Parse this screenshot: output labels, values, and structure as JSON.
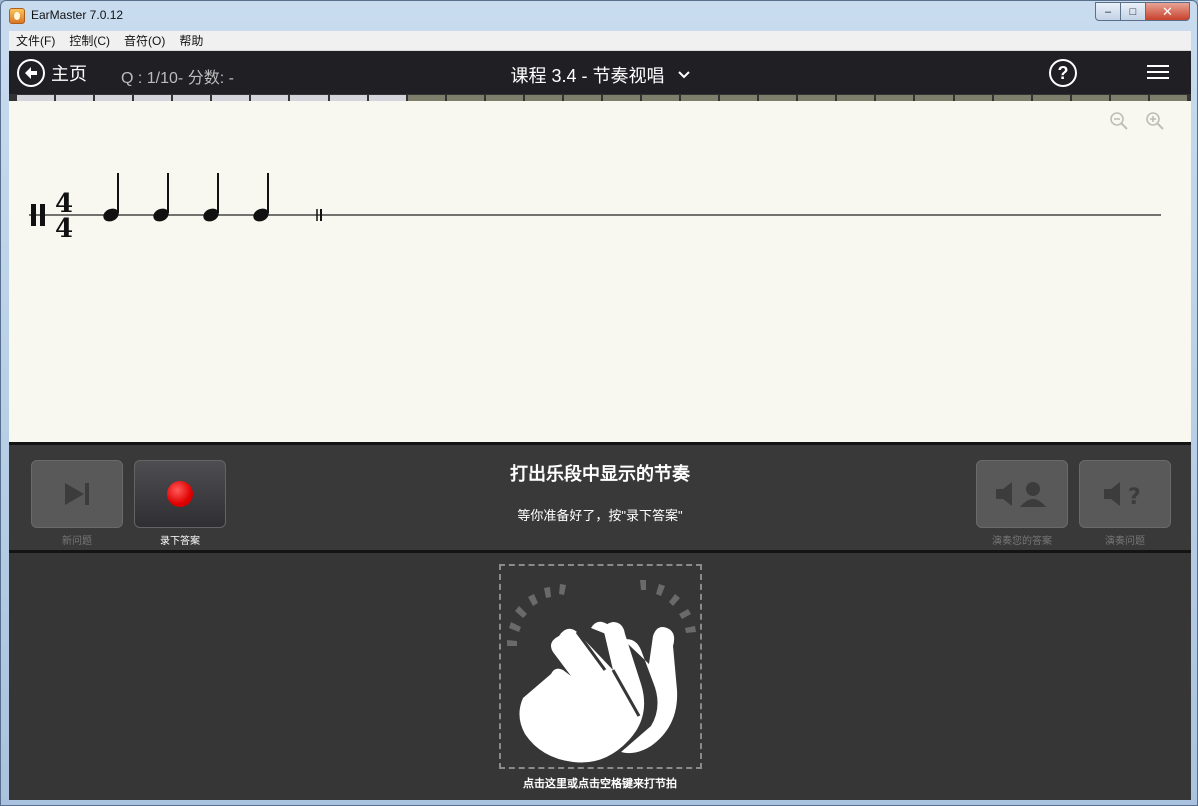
{
  "window": {
    "title": "EarMaster 7.0.12",
    "minimize": "–",
    "maximize": "□",
    "close": "✕"
  },
  "menubar": [
    "文件(F)",
    "控制(C)",
    "音符(O)",
    "帮助"
  ],
  "topbar": {
    "home_label": "主页",
    "question_info": "Q : 1/10- 分数: -",
    "lesson_title": "课程 3.4 - 节奏视唱",
    "help_label": "?"
  },
  "progress": {
    "total_segments": 30,
    "completed_segments": 10,
    "done_color": "#d3d4dc",
    "pending_color": "#7e7e6c"
  },
  "score": {
    "time_signature": {
      "numerator": "4",
      "denominator": "4"
    },
    "notes": [
      "quarter",
      "quarter",
      "quarter",
      "quarter"
    ]
  },
  "controls": {
    "instruction_title": "打出乐段中显示的节奏",
    "instruction_sub": "等你准备好了，按\"录下答案\"",
    "buttons": [
      {
        "id": "new-question",
        "label": "新问题",
        "icon": "skip-next-icon",
        "enabled": false
      },
      {
        "id": "record-answer",
        "label": "录下答案",
        "icon": "record-icon",
        "enabled": true
      },
      {
        "id": "play-your-answer",
        "label": "演奏您的答案",
        "icon": "speaker-person-icon",
        "enabled": false
      },
      {
        "id": "play-question",
        "label": "演奏问题",
        "icon": "speaker-question-icon",
        "enabled": false
      }
    ]
  },
  "tap_area": {
    "label": "点击这里或点击空格键来打节拍",
    "icon": "clapping-hands-icon"
  },
  "colors": {
    "record": "#e00000",
    "topbar": "#1f1f24",
    "panel": "#393939"
  }
}
